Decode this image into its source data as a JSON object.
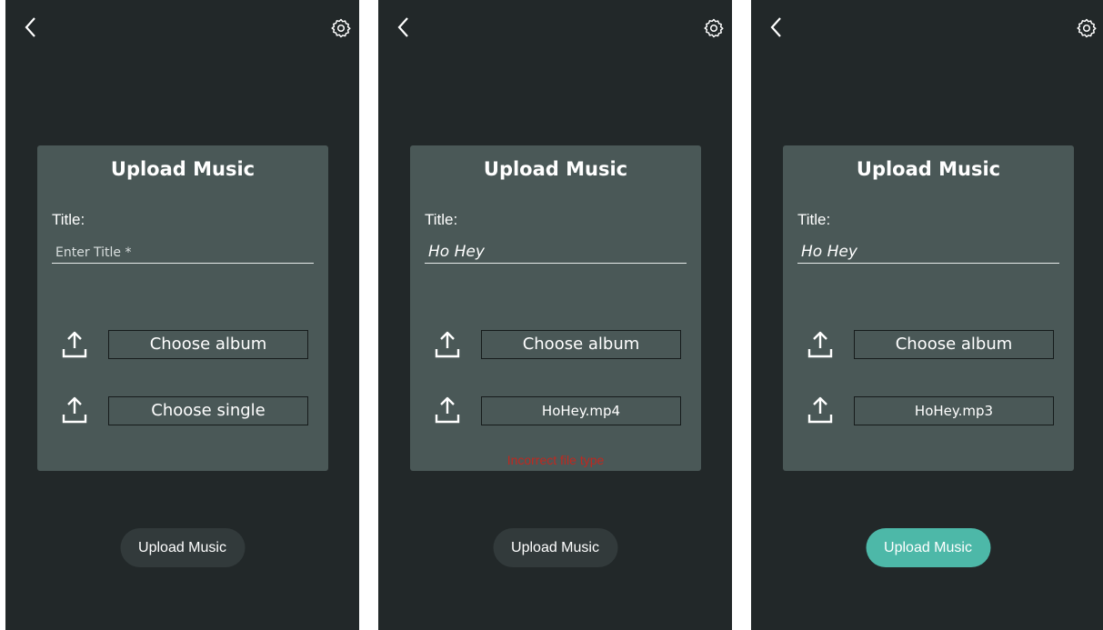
{
  "colors": {
    "screen_bg": "#222829",
    "card_bg": "#4a5857",
    "error": "#c0281f",
    "button_inactive": "#323a3b",
    "button_active": "#4db8a8"
  },
  "icons": {
    "back": "chevron-left",
    "settings": "gear",
    "upload": "upload-arrow"
  },
  "screens": [
    {
      "card_title": "Upload Music",
      "title_label": "Title:",
      "title_value": "",
      "title_placeholder": "Enter Title *",
      "album_button": "Choose album",
      "single_button": "Choose single",
      "error": "",
      "submit": "Upload Music",
      "submit_enabled": false
    },
    {
      "card_title": "Upload Music",
      "title_label": "Title:",
      "title_value": "Ho Hey",
      "title_placeholder": "Enter Title *",
      "album_button": "Choose album",
      "single_button": "HoHey.mp4",
      "error": "Incorrect file type",
      "submit": "Upload Music",
      "submit_enabled": false
    },
    {
      "card_title": "Upload Music",
      "title_label": "Title:",
      "title_value": "Ho Hey",
      "title_placeholder": "Enter Title *",
      "album_button": "Choose album",
      "single_button": "HoHey.mp3",
      "error": "",
      "submit": "Upload Music",
      "submit_enabled": true
    }
  ]
}
